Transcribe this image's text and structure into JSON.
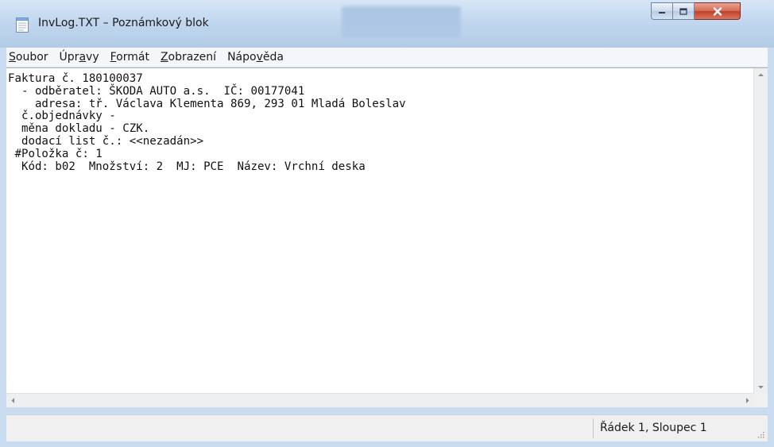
{
  "window": {
    "title": "InvLog.TXT – Poznámkový blok"
  },
  "menu": {
    "items": [
      {
        "pre": "",
        "key": "S",
        "post": "oubor"
      },
      {
        "pre": "Úpr",
        "key": "a",
        "post": "vy"
      },
      {
        "pre": "",
        "key": "F",
        "post": "ormát"
      },
      {
        "pre": "",
        "key": "Z",
        "post": "obrazení"
      },
      {
        "pre": "Nápo",
        "key": "v",
        "post": "ěda"
      }
    ]
  },
  "editor": {
    "lines": [
      "Faktura č. 180100037",
      "  - odběratel: ŠKODA AUTO a.s.  IČ: 00177041",
      "    adresa: tř. Václava Klementa 869, 293 01 Mladá Boleslav",
      "  č.objednávky -",
      "  měna dokladu - CZK.",
      "  dodací list č.: <<nezadán>>",
      " #Položka č: 1",
      "  Kód: b02  Množství: 2  MJ: PCE  Název: Vrchní deska"
    ]
  },
  "status": {
    "position": "Řádek 1, Sloupec 1"
  },
  "icons": {
    "app": "notepad-icon",
    "minimize": "minimize-icon",
    "maximize": "maximize-icon",
    "close": "close-icon"
  },
  "colors": {
    "frame": "#c9dcf0",
    "close_button": "#c2402a",
    "editor_bg": "#ffffff"
  }
}
